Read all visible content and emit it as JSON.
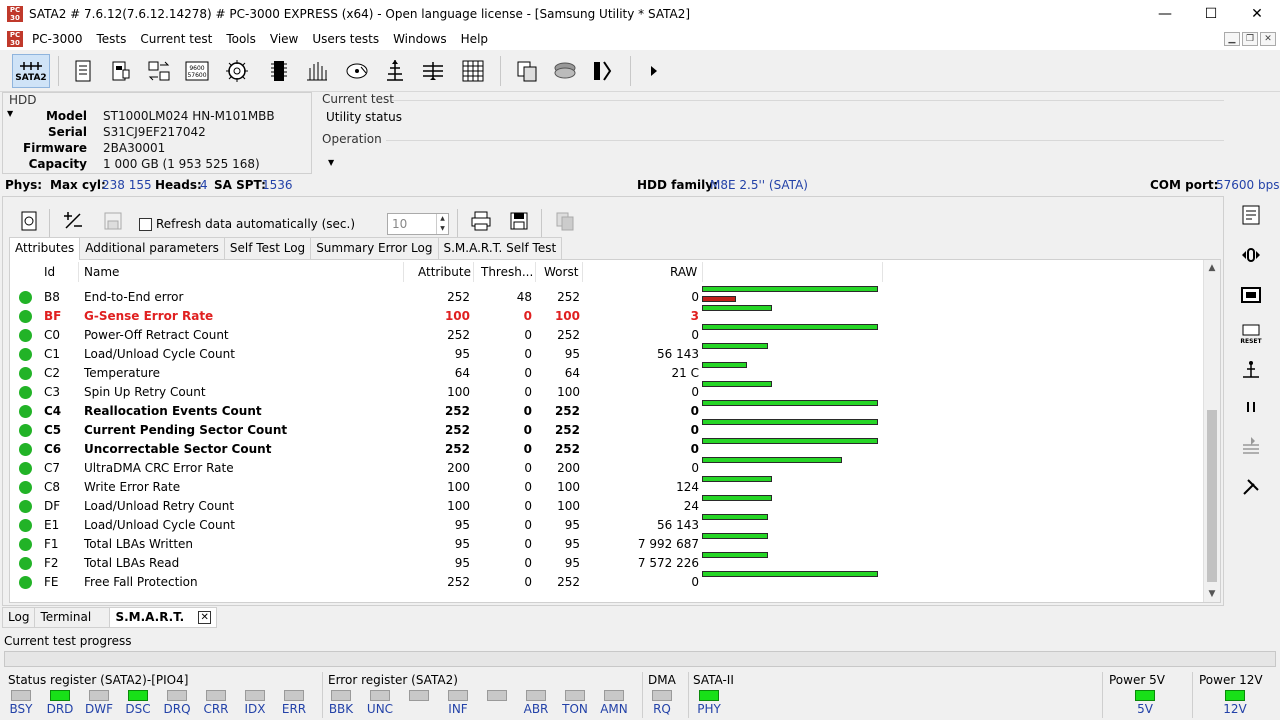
{
  "window": {
    "title": "SATA2 # 7.6.12(7.6.12.14278) # PC-3000 EXPRESS (x64) - Open language license - [Samsung Utility * SATA2]",
    "logo_text": "PC-3000",
    "min": "—",
    "max": "☐",
    "close": "✕"
  },
  "menu": {
    "items": [
      "PC-3000",
      "Tests",
      "Current test",
      "Tools",
      "View",
      "Users tests",
      "Windows",
      "Help"
    ]
  },
  "toolbar": {
    "sata_label": "SATA2",
    "icon_label_9600": "9600",
    "icon_label_57600": "57600"
  },
  "hdd": {
    "title": "HDD",
    "model_key": "Model",
    "model": "ST1000LM024 HN-M101MBB",
    "serial_key": "Serial",
    "serial": "S31CJ9EF217042",
    "firmware_key": "Firmware",
    "firmware": "2BA30001",
    "capacity_key": "Capacity",
    "capacity": "1 000 GB (1 953 525 168)"
  },
  "current_test": {
    "label": "Current test",
    "value": "Utility status",
    "operation_label": "Operation"
  },
  "phys": {
    "label": "Phys:",
    "maxcyl_key": "Max cyl:",
    "maxcyl": "238 155",
    "heads_key": "Heads:",
    "heads": "4",
    "spt_key": "SA SPT:",
    "spt": "1536",
    "family_key": "HDD family:",
    "family": "M8E 2.5'' (SATA)",
    "com_key": "COM port:",
    "com": "57600 bps"
  },
  "smart": {
    "refresh_label": "Refresh data automatically (sec.)",
    "refresh_value": "10",
    "tabs": [
      "Attributes",
      "Additional parameters",
      "Self Test Log",
      "Summary Error Log",
      "S.M.A.R.T. Self Test"
    ],
    "headers": {
      "id": "Id",
      "name": "Name",
      "attribute": "Attribute",
      "thresh": "Thresh...",
      "worst": "Worst",
      "raw": "RAW"
    },
    "rows": [
      {
        "id": "B8",
        "name": "End-to-End error",
        "attr": "252",
        "thresh": "48",
        "worst": "252",
        "raw": "0"
      },
      {
        "id": "BF",
        "name": "G-Sense Error Rate",
        "attr": "100",
        "thresh": "0",
        "worst": "100",
        "raw": "3"
      },
      {
        "id": "C0",
        "name": "Power-Off Retract Count",
        "attr": "252",
        "thresh": "0",
        "worst": "252",
        "raw": "0"
      },
      {
        "id": "C1",
        "name": "Load/Unload Cycle Count",
        "attr": "95",
        "thresh": "0",
        "worst": "95",
        "raw": "56 143"
      },
      {
        "id": "C2",
        "name": "Temperature",
        "attr": "64",
        "thresh": "0",
        "worst": "64",
        "raw": "21 C"
      },
      {
        "id": "C3",
        "name": "Spin Up Retry Count",
        "attr": "100",
        "thresh": "0",
        "worst": "100",
        "raw": "0"
      },
      {
        "id": "C4",
        "name": "Reallocation Events Count",
        "attr": "252",
        "thresh": "0",
        "worst": "252",
        "raw": "0"
      },
      {
        "id": "C5",
        "name": "Current Pending Sector Count",
        "attr": "252",
        "thresh": "0",
        "worst": "252",
        "raw": "0"
      },
      {
        "id": "C6",
        "name": "Uncorrectable Sector Count",
        "attr": "252",
        "thresh": "0",
        "worst": "252",
        "raw": "0"
      },
      {
        "id": "C7",
        "name": "UltraDMA CRC Error Rate",
        "attr": "200",
        "thresh": "0",
        "worst": "200",
        "raw": "0"
      },
      {
        "id": "C8",
        "name": "Write Error Rate",
        "attr": "100",
        "thresh": "0",
        "worst": "100",
        "raw": "124"
      },
      {
        "id": "DF",
        "name": "Load/Unload Retry Count",
        "attr": "100",
        "thresh": "0",
        "worst": "100",
        "raw": "24"
      },
      {
        "id": "E1",
        "name": "Load/Unload Cycle Count",
        "attr": "95",
        "thresh": "0",
        "worst": "95",
        "raw": "56 143"
      },
      {
        "id": "F1",
        "name": "Total LBAs Written",
        "attr": "95",
        "thresh": "0",
        "worst": "95",
        "raw": "7 992 687"
      },
      {
        "id": "F2",
        "name": "Total LBAs Read",
        "attr": "95",
        "thresh": "0",
        "worst": "95",
        "raw": "7 572 226"
      },
      {
        "id": "FE",
        "name": "Free Fall Protection",
        "attr": "252",
        "thresh": "0",
        "worst": "252",
        "raw": "0"
      }
    ]
  },
  "bottom_tabs": [
    "Log",
    "Terminal",
    "S.M.A.R.T."
  ],
  "progress": {
    "label": "Current test progress"
  },
  "status_register": {
    "title": "Status register (SATA2)-[PIO4]",
    "leds": [
      {
        "label": "BSY",
        "on": false
      },
      {
        "label": "DRD",
        "on": true
      },
      {
        "label": "DWF",
        "on": false
      },
      {
        "label": "DSC",
        "on": true
      },
      {
        "label": "DRQ",
        "on": false
      },
      {
        "label": "CRR",
        "on": false
      },
      {
        "label": "IDX",
        "on": false
      },
      {
        "label": "ERR",
        "on": false
      }
    ]
  },
  "error_register": {
    "title": "Error register (SATA2)",
    "leds": [
      {
        "label": "BBK",
        "on": false
      },
      {
        "label": "UNC",
        "on": false
      },
      {
        "label": "",
        "on": false
      },
      {
        "label": "INF",
        "on": false
      },
      {
        "label": "",
        "on": false
      },
      {
        "label": "ABR",
        "on": false
      },
      {
        "label": "TON",
        "on": false
      },
      {
        "label": "AMN",
        "on": false
      }
    ]
  },
  "dma": {
    "title": "DMA",
    "label": "RQ",
    "on": false
  },
  "sata": {
    "title": "SATA-II",
    "label": "PHY",
    "on": true
  },
  "power5": {
    "title": "Power 5V",
    "label": "5V",
    "on": true
  },
  "power12": {
    "title": "Power 12V",
    "label": "12V",
    "on": true
  },
  "colors": {
    "ok": "#22b327",
    "warn": "#e02020",
    "bar_ok": "#26d626",
    "bar_warn": "#c0201a",
    "accent_blue": "#2342a8"
  }
}
